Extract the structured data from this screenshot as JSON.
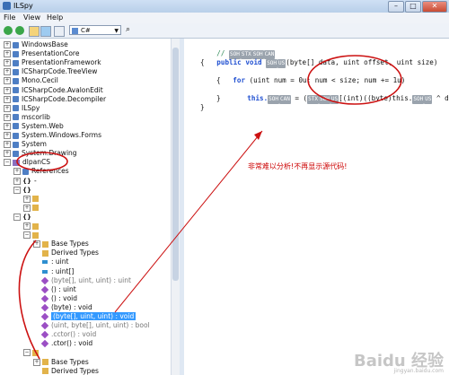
{
  "window": {
    "title": "ILSpy",
    "minimize": "–",
    "maximize": "□",
    "close": "✕"
  },
  "menu": [
    "File",
    "View",
    "Help"
  ],
  "toolbar": {
    "language": "C#"
  },
  "tree": [
    {
      "label": "WindowsBase",
      "kind": "ref",
      "indent": 0,
      "exp": "+"
    },
    {
      "label": "PresentationCore",
      "kind": "ref",
      "indent": 0,
      "exp": "+"
    },
    {
      "label": "PresentationFramework",
      "kind": "ref",
      "indent": 0,
      "exp": "+"
    },
    {
      "label": "ICSharpCode.TreeView",
      "kind": "ref",
      "indent": 0,
      "exp": "+"
    },
    {
      "label": "Mono.Cecil",
      "kind": "ref",
      "indent": 0,
      "exp": "+"
    },
    {
      "label": "ICSharpCode.AvalonEdit",
      "kind": "ref",
      "indent": 0,
      "exp": "+"
    },
    {
      "label": "ICSharpCode.Decompiler",
      "kind": "ref",
      "indent": 0,
      "exp": "+"
    },
    {
      "label": "ILSpy",
      "kind": "ref",
      "indent": 0,
      "exp": "+"
    },
    {
      "label": "mscorlib",
      "kind": "ref",
      "indent": 0,
      "exp": "+"
    },
    {
      "label": "System.Web",
      "kind": "ref",
      "indent": 0,
      "exp": "+"
    },
    {
      "label": "System.Windows.Forms",
      "kind": "ref",
      "indent": 0,
      "exp": "+"
    },
    {
      "label": "System",
      "kind": "ref",
      "indent": 0,
      "exp": "+"
    },
    {
      "label": "System.Drawing",
      "kind": "ref",
      "indent": 0,
      "exp": "+"
    },
    {
      "label": "dlpanCS",
      "kind": "asm",
      "indent": 0,
      "exp": "−"
    },
    {
      "label": "References",
      "kind": "ref",
      "indent": 1,
      "exp": "+"
    },
    {
      "label": "-",
      "kind": "ns",
      "indent": 1,
      "exp": "+"
    },
    {
      "label": "",
      "kind": "ns",
      "indent": 1,
      "exp": "−"
    },
    {
      "label": "",
      "kind": "type",
      "indent": 2,
      "exp": "+"
    },
    {
      "label": "",
      "kind": "type",
      "indent": 2,
      "exp": "+"
    },
    {
      "label": "",
      "kind": "ns",
      "indent": 1,
      "exp": "−"
    },
    {
      "label": "",
      "kind": "type",
      "indent": 2,
      "exp": "+"
    },
    {
      "label": "",
      "kind": "type",
      "indent": 2,
      "exp": "−"
    },
    {
      "label": "Base Types",
      "kind": "type",
      "indent": 3,
      "exp": "+"
    },
    {
      "label": "Derived Types",
      "kind": "type",
      "indent": 3,
      "exp": ""
    },
    {
      "label": ": uint",
      "kind": "field",
      "indent": 3,
      "exp": ""
    },
    {
      "label": ": uint[]",
      "kind": "field",
      "indent": 3,
      "exp": ""
    },
    {
      "label": "(byte[], uint, uint) : uint",
      "kind": "method",
      "indent": 3,
      "exp": "",
      "grey": true
    },
    {
      "label": "() : uint",
      "kind": "method",
      "indent": 3,
      "exp": ""
    },
    {
      "label": "() : void",
      "kind": "method",
      "indent": 3,
      "exp": ""
    },
    {
      "label": "(byte) : void",
      "kind": "method",
      "indent": 3,
      "exp": ""
    },
    {
      "label": "(byte[], uint, uint) : void",
      "kind": "method",
      "indent": 3,
      "exp": "",
      "selected": true
    },
    {
      "label": "(uint, byte[], uint, uint) : bool",
      "kind": "method",
      "indent": 3,
      "exp": "",
      "grey": true
    },
    {
      "label": ".cctor() : void",
      "kind": "method",
      "indent": 3,
      "exp": "",
      "grey": true
    },
    {
      "label": ".ctor() : void",
      "kind": "method",
      "indent": 3,
      "exp": ""
    },
    {
      "label": "",
      "kind": "type",
      "indent": 2,
      "exp": "−"
    },
    {
      "label": "Base Types",
      "kind": "type",
      "indent": 3,
      "exp": "+"
    },
    {
      "label": "Derived Types",
      "kind": "type",
      "indent": 3,
      "exp": ""
    }
  ],
  "code": {
    "line1_comment": "//",
    "line2_public": "public",
    "line2_void": "void",
    "line2_params": "(byte[] data, uint offset, uint size)",
    "brace_open": "{",
    "line4_for": "for",
    "line4_rest": "(uint num = 0u; num < size; num += 1u)",
    "line6_this": "this.",
    "line6_mid": " = (",
    "line6_tail": "[(int)((byte)this.",
    "line6_end": " ^ dat",
    "brace_close": "}",
    "ctl_tokens": [
      "SOH",
      "STX",
      "SOH",
      "CAN",
      "SOH",
      "US",
      "SOH",
      "CAN",
      "STX",
      "SOH",
      "US"
    ]
  },
  "annotation": {
    "text": "非常难以分析!不再显示源代码!",
    "color": "#cc0000"
  },
  "watermark": {
    "text": "Baidu 经验",
    "sub": "jingyan.baidu.com"
  }
}
